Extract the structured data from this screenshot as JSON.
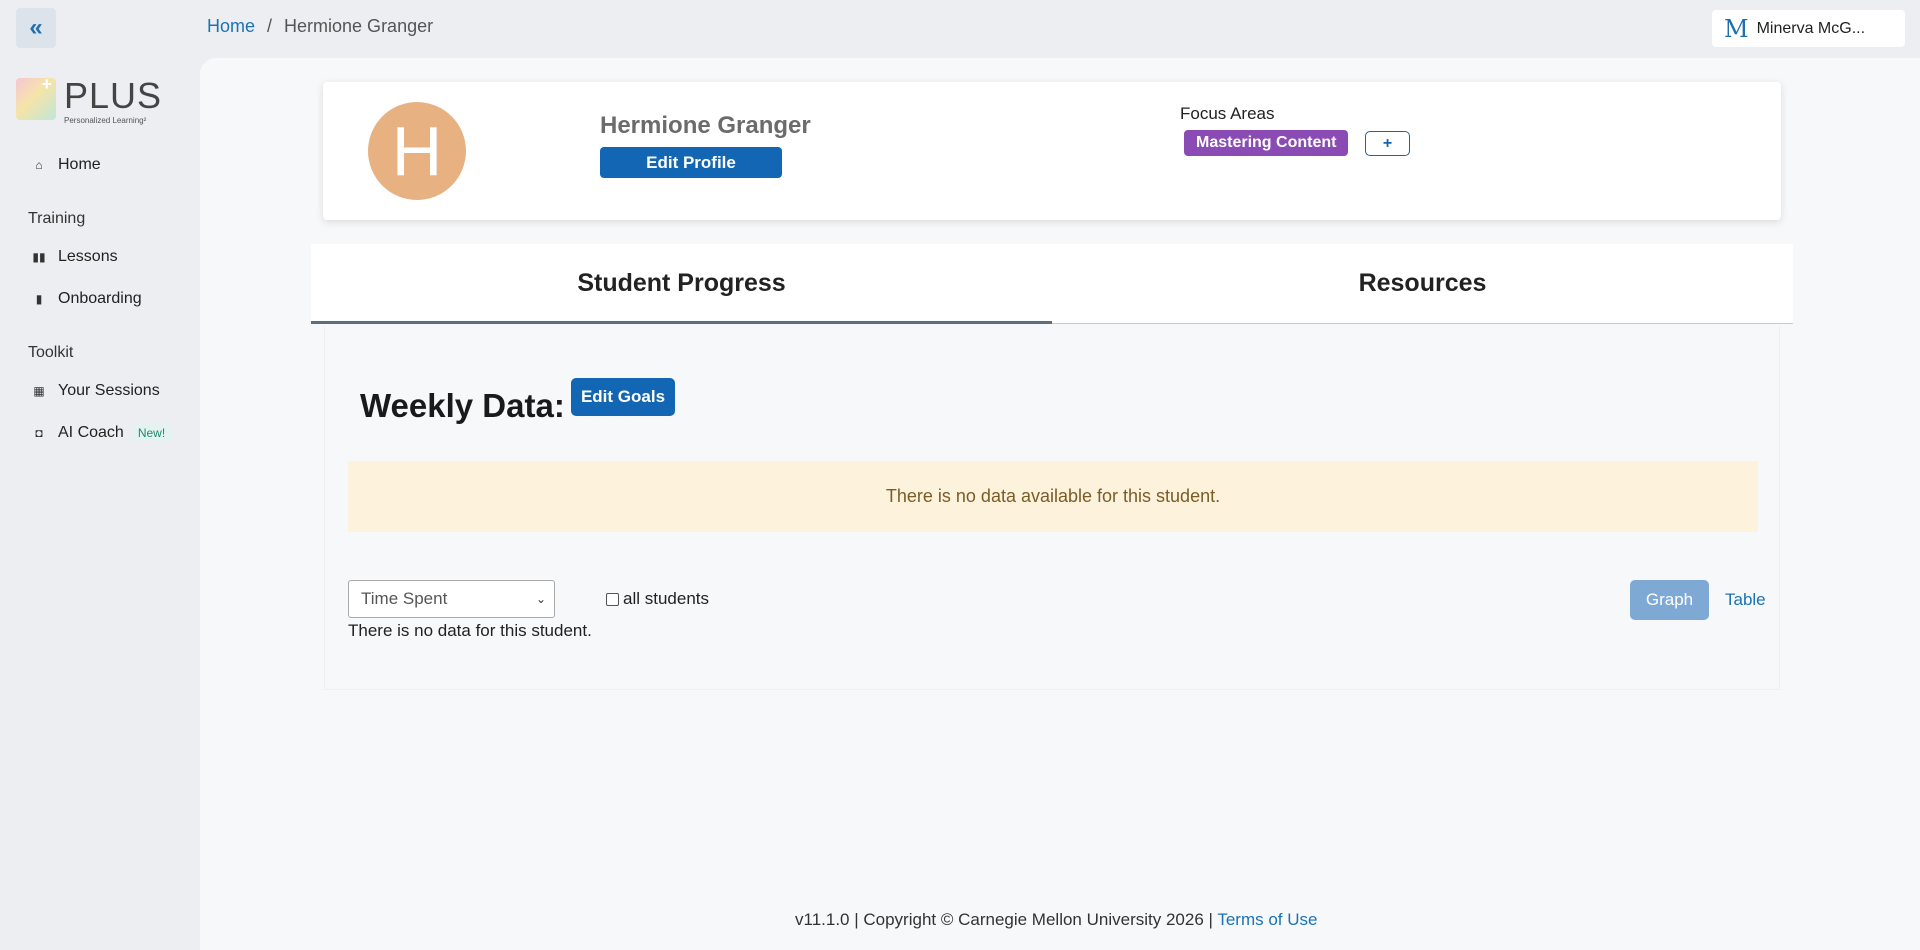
{
  "topbar": {
    "breadcrumb": {
      "home": "Home",
      "separator": "/",
      "current": "Hermione Granger"
    },
    "user": {
      "logo": "M",
      "name": "Minerva McG..."
    }
  },
  "sidebar": {
    "logo": {
      "title": "PLUS",
      "subtitle": "Personalized Learning²"
    },
    "home": {
      "label": "Home",
      "icon": "home-icon"
    },
    "sections": [
      {
        "title": "Training",
        "items": [
          {
            "label": "Lessons",
            "icon": "book-icon"
          },
          {
            "label": "Onboarding",
            "icon": "clipboard-icon"
          }
        ]
      },
      {
        "title": "Toolkit",
        "items": [
          {
            "label": "Your Sessions",
            "icon": "calendar-icon"
          },
          {
            "label": "AI Coach",
            "icon": "robot-icon",
            "badge": "New!"
          }
        ]
      }
    ]
  },
  "profile": {
    "initial": "H",
    "name": "Hermione Granger",
    "edit_label": "Edit Profile",
    "focus_label": "Focus Areas",
    "focus_areas": [
      "Mastering Content"
    ],
    "add_focus_label": "+",
    "colors": {
      "avatar": "#e8b182",
      "focus_badge": "#8a4bb5",
      "primary": "#1266b3"
    }
  },
  "tabs": [
    {
      "label": "Student Progress",
      "active": true
    },
    {
      "label": "Resources",
      "active": false
    }
  ],
  "weekly": {
    "title": "Weekly Data:",
    "edit_goals_label": "Edit Goals",
    "alert": "There is no data available for this student.",
    "metric_selected": "Time Spent",
    "all_students_label": "all students",
    "all_students_checked": false,
    "no_data_text": "There is no data for this student.",
    "graph_label": "Graph",
    "table_label": "Table"
  },
  "footer": {
    "text": "v11.1.0 | Copyright © Carnegie Mellon University 2026 | ",
    "terms_label": "Terms of Use"
  }
}
